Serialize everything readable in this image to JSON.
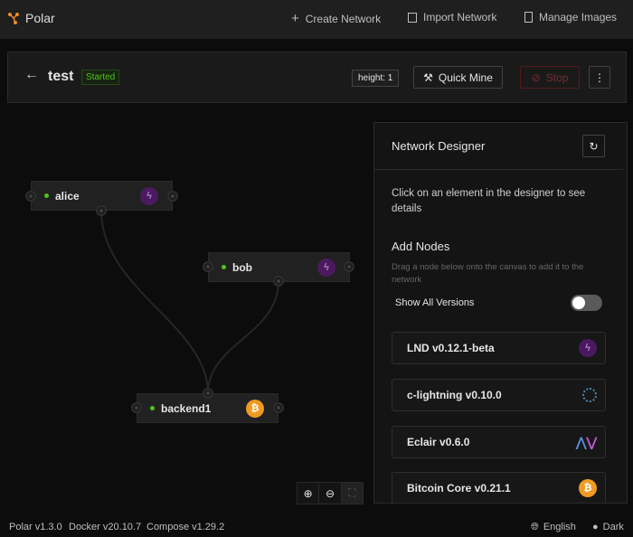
{
  "app": {
    "title": "Polar"
  },
  "nav": {
    "create": "Create Network",
    "import": "Import Network",
    "manage": "Manage Images"
  },
  "network": {
    "name": "test",
    "status": "Started",
    "height": "height: 1",
    "quick_mine": "Quick Mine",
    "stop": "Stop"
  },
  "nodes": [
    {
      "name": "alice",
      "type": "lnd"
    },
    {
      "name": "bob",
      "type": "lnd"
    },
    {
      "name": "backend1",
      "type": "bitcoin"
    }
  ],
  "panel": {
    "title": "Network Designer",
    "hint": "Click on an element in the designer to see details",
    "add_title": "Add Nodes",
    "add_desc": "Drag a node below onto the canvas to add it to the network",
    "show_all": "Show All Versions",
    "show_all_on": false,
    "items": [
      {
        "label": "LND v0.12.1-beta",
        "icon": "lightning-icon"
      },
      {
        "label": "c-lightning v0.10.0",
        "icon": "c-lightning-icon"
      },
      {
        "label": "Eclair v0.6.0",
        "icon": "eclair-icon"
      },
      {
        "label": "Bitcoin Core v0.21.1",
        "icon": "bitcoin-icon"
      }
    ]
  },
  "footer": {
    "polar": "Polar v1.3.0",
    "docker": "Docker v20.10.7",
    "compose": "Compose v1.29.2",
    "language": "English",
    "theme": "Dark"
  },
  "colors": {
    "started": "#52c41a",
    "stop": "#a61d24",
    "lnd": "#4b1a5e",
    "bitcoin": "#f09a22"
  }
}
